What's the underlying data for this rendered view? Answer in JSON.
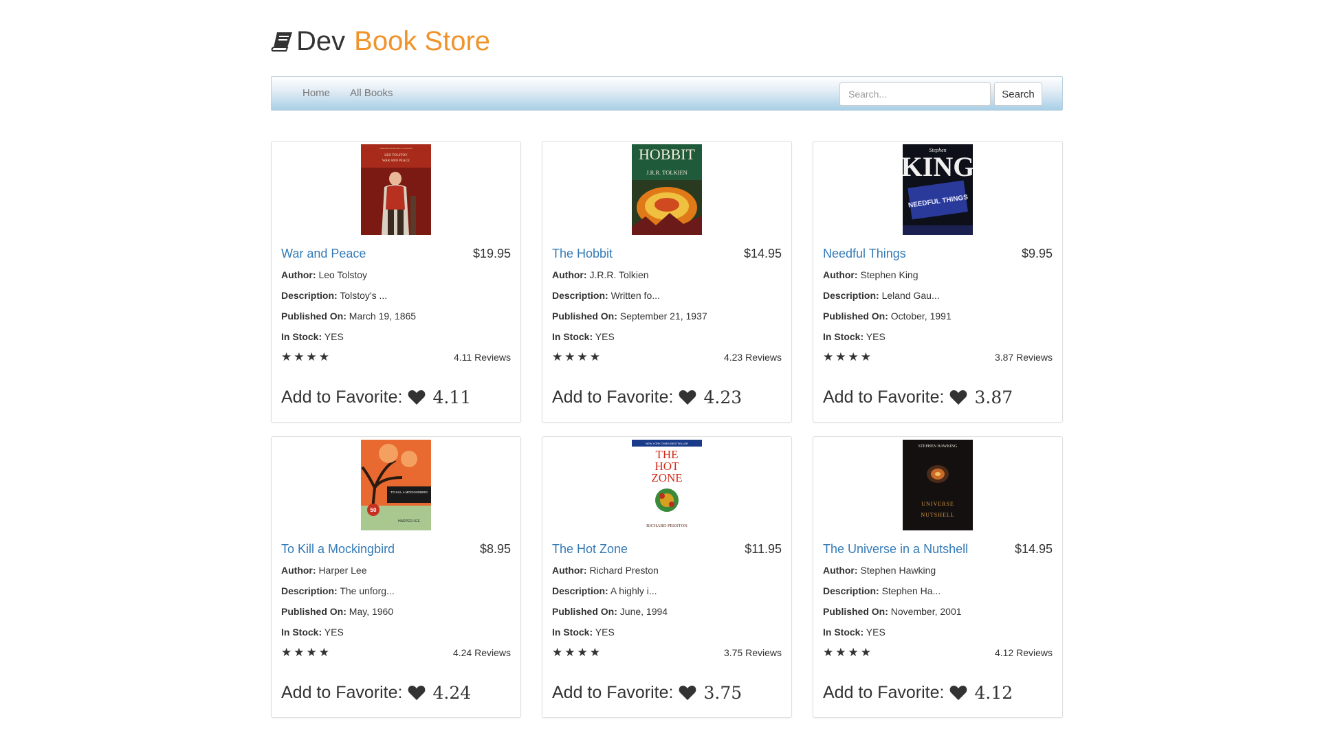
{
  "brand": {
    "prefix": "Dev",
    "suffix": "Book Store",
    "icon": "book-icon",
    "accent_color": "#f0932b"
  },
  "nav": {
    "links": [
      {
        "label": "Home"
      },
      {
        "label": "All Books"
      }
    ],
    "search": {
      "placeholder": "Search...",
      "value": "",
      "button_label": "Search"
    }
  },
  "labels": {
    "author": "Author:",
    "description": "Description:",
    "published": "Published On:",
    "in_stock": "In Stock:",
    "add_favorite": "Add to Favorite:"
  },
  "books": [
    {
      "title": "War and Peace",
      "price": "$19.95",
      "author": "Leo Tolstoy",
      "description": "Tolstoy's ...",
      "published": "March 19, 1865",
      "in_stock": "YES",
      "stars": "★★★★",
      "reviews": "4.11 Reviews",
      "favorite": "4.11"
    },
    {
      "title": "The Hobbit",
      "price": "$14.95",
      "author": "J.R.R. Tolkien",
      "description": "Written fo...",
      "published": "September 21, 1937",
      "in_stock": "YES",
      "stars": "★★★★",
      "reviews": "4.23 Reviews",
      "favorite": "4.23"
    },
    {
      "title": "Needful Things",
      "price": "$9.95",
      "author": "Stephen King",
      "description": "Leland Gau...",
      "published": "October, 1991",
      "in_stock": "YES",
      "stars": "★★★★",
      "reviews": "3.87 Reviews",
      "favorite": "3.87"
    },
    {
      "title": "To Kill a Mockingbird",
      "price": "$8.95",
      "author": "Harper Lee",
      "description": "The unforg...",
      "published": "May, 1960",
      "in_stock": "YES",
      "stars": "★★★★",
      "reviews": "4.24 Reviews",
      "favorite": "4.24"
    },
    {
      "title": "The Hot Zone",
      "price": "$11.95",
      "author": "Richard Preston",
      "description": "A highly i...",
      "published": "June, 1994",
      "in_stock": "YES",
      "stars": "★★★★",
      "reviews": "3.75 Reviews",
      "favorite": "3.75"
    },
    {
      "title": "The Universe in a Nutshell",
      "price": "$14.95",
      "author": "Stephen Hawking",
      "description": "Stephen Ha...",
      "published": "November, 2001",
      "in_stock": "YES",
      "stars": "★★★★",
      "reviews": "4.12 Reviews",
      "favorite": "4.12"
    }
  ],
  "covers": [
    {
      "lines": [
        "OXFORD WORLD'S CLASSICS",
        "LEO TOLSTOY",
        "WAR AND PEACE"
      ]
    },
    {
      "lines": [
        "HOBBIT",
        "J.R.R. TOLKIEN"
      ]
    },
    {
      "lines": [
        "Stephen",
        "KING",
        "NEEDFUL THINGS"
      ]
    },
    {
      "lines": [
        "TO KILL A MOCKINGBIRD",
        "50",
        "HARPER LEE"
      ]
    },
    {
      "lines": [
        "NEW YORK TIMES BESTSELLER",
        "THE",
        "HOT",
        "ZONE",
        "RICHARD PRESTON"
      ]
    },
    {
      "lines": [
        "STEPHEN HAWKING",
        "UNIVERSE",
        "NUTSHELL"
      ]
    }
  ]
}
